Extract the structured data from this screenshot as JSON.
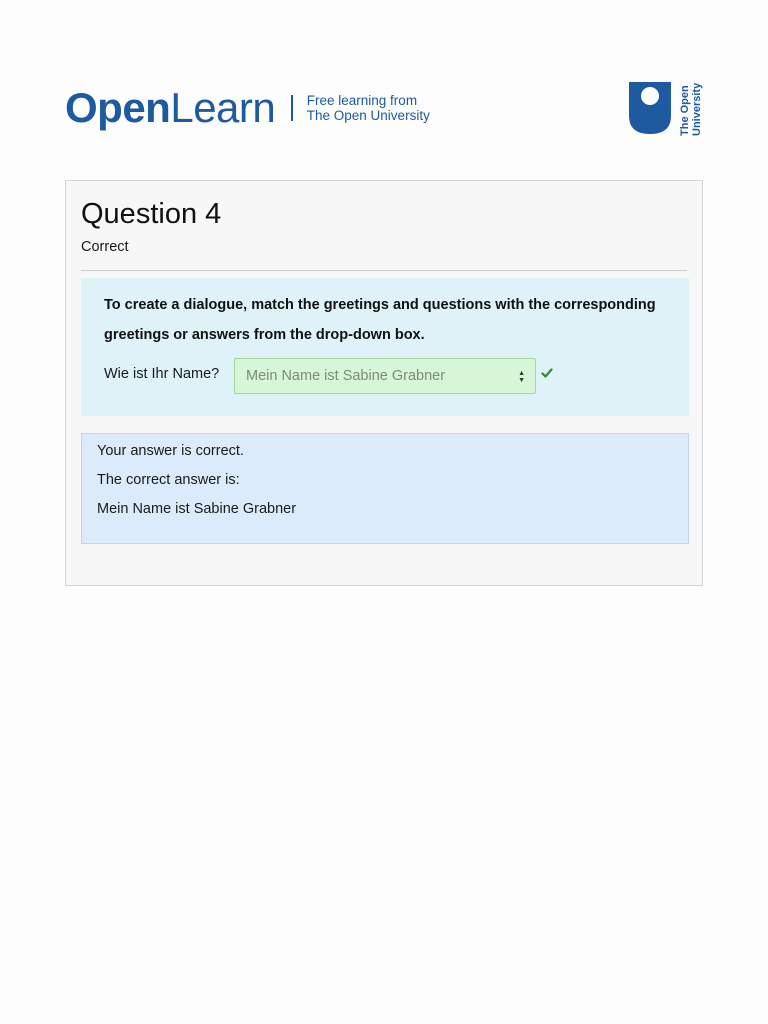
{
  "header": {
    "brand_part1": "Open",
    "brand_part2": "Learn",
    "tagline_line1": "Free learning from",
    "tagline_line2": "The Open University",
    "ou_line1": "The Open",
    "ou_line2": "University"
  },
  "question": {
    "title": "Question 4",
    "status": "Correct",
    "prompt": "To create a dialogue, match the greetings and questions with the corresponding greetings or answers from the drop-down box.",
    "item_label": "Wie ist Ihr Name?",
    "selected_answer": "Mein Name ist Sabine Grabner"
  },
  "feedback": {
    "result": "Your answer is correct.",
    "correct_answer_heading": "The correct answer is:",
    "correct_answer": "Mein Name ist Sabine Grabner"
  },
  "colors": {
    "brand_blue": "#1d5aa0",
    "correct_green": "#2e8b2e",
    "formulation_bg": "#def2f8",
    "outcome_bg": "#dcebfc",
    "select_bg": "#d7f5d7"
  },
  "icons": {
    "logo": "open-university-shield-icon",
    "status": "check-icon",
    "select": "updown-arrows-icon"
  }
}
